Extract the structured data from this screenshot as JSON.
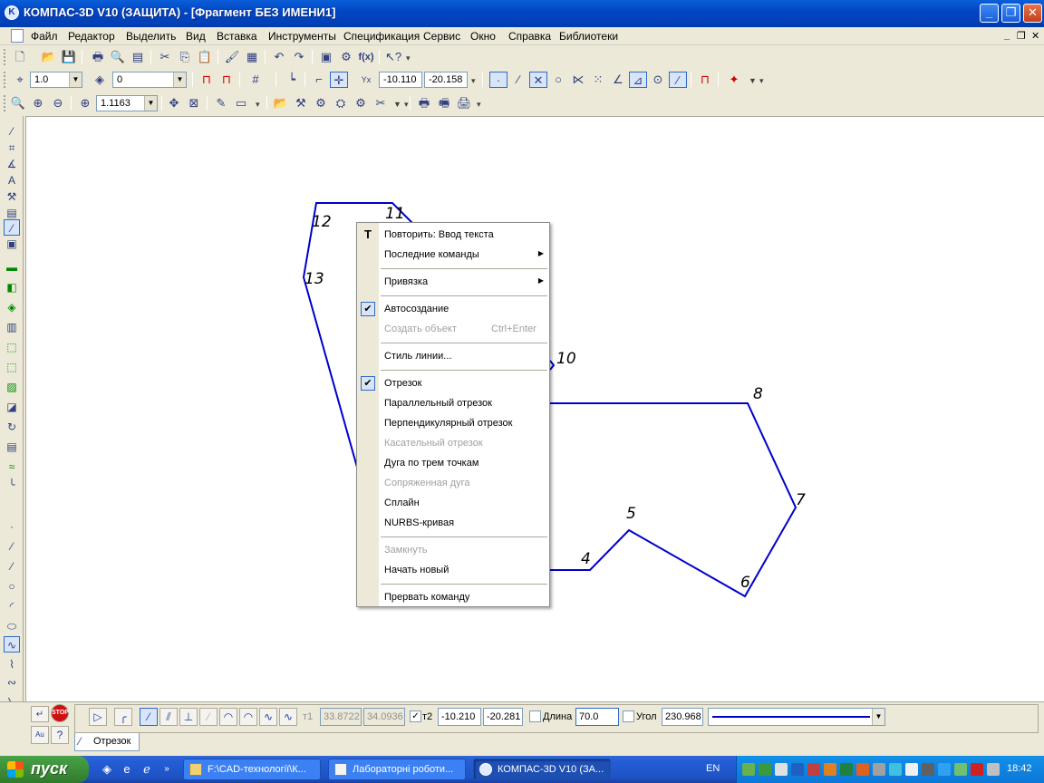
{
  "window": {
    "title": "КОМПАС-3D V10 (ЗАЩИТА) - [Фрагмент БЕЗ ИМЕНИ1]",
    "min": "_",
    "max": "❐",
    "close": "✕"
  },
  "menu": [
    "Файл",
    "Редактор",
    "Выделить",
    "Вид",
    "Вставка",
    "Инструменты",
    "Спецификация",
    "Сервис",
    "Окно",
    "Справка",
    "Библиотеки"
  ],
  "mdi_controls": {
    "min": "_",
    "restore": "❐",
    "close": "✕"
  },
  "toolbar2": {
    "step": "1.0",
    "style": "0",
    "coord_x": "-10.110",
    "coord_y": "-20.158"
  },
  "toolbar3": {
    "zoom": "1.1163"
  },
  "context_menu": {
    "items": [
      {
        "label": "Повторить: Ввод текста",
        "icon": "T"
      },
      {
        "label": "Последние команды",
        "submenu": true
      },
      {
        "label": "Привязка",
        "submenu": true
      },
      {
        "label": "Автосоздание",
        "checked": true
      },
      {
        "label": "Создать объект",
        "shortcut": "Ctrl+Enter",
        "disabled": true
      },
      {
        "label": "Стиль линии..."
      },
      {
        "label": "Отрезок",
        "checked": true
      },
      {
        "label": "Параллельный отрезок"
      },
      {
        "label": "Перпендикулярный отрезок"
      },
      {
        "label": "Касательный отрезок",
        "disabled": true
      },
      {
        "label": "Дуга по трем точкам"
      },
      {
        "label": "Сопряженная дуга",
        "disabled": true
      },
      {
        "label": "Сплайн"
      },
      {
        "label": "NURBS-кривая"
      },
      {
        "label": "Замкнуть",
        "disabled": true
      },
      {
        "label": "Начать новый"
      },
      {
        "label": "Прервать команду"
      }
    ]
  },
  "drawing": {
    "point_labels": [
      "4",
      "5",
      "6",
      "7",
      "8",
      "10",
      "11",
      "12",
      "13"
    ],
    "line_color": "#0000cc"
  },
  "property_bar": {
    "t1_label": "т1",
    "t1_x": "33.8722",
    "t1_y": "34.0936",
    "t2_label": "т2",
    "t2_x": "-10.210",
    "t2_y": "-20.281",
    "length_label": "Длина",
    "length_value": "70.0",
    "angle_label": "Угол",
    "angle_value": "230.968",
    "tab_label": "Отрезок"
  },
  "taskbar": {
    "start": "пуск",
    "tasks": [
      "F:\\CAD-технології\\К...",
      "Лабораторні роботи...",
      "КОМПАС-3D V10 (ЗА..."
    ],
    "lang": "EN",
    "clock": "18:42"
  }
}
